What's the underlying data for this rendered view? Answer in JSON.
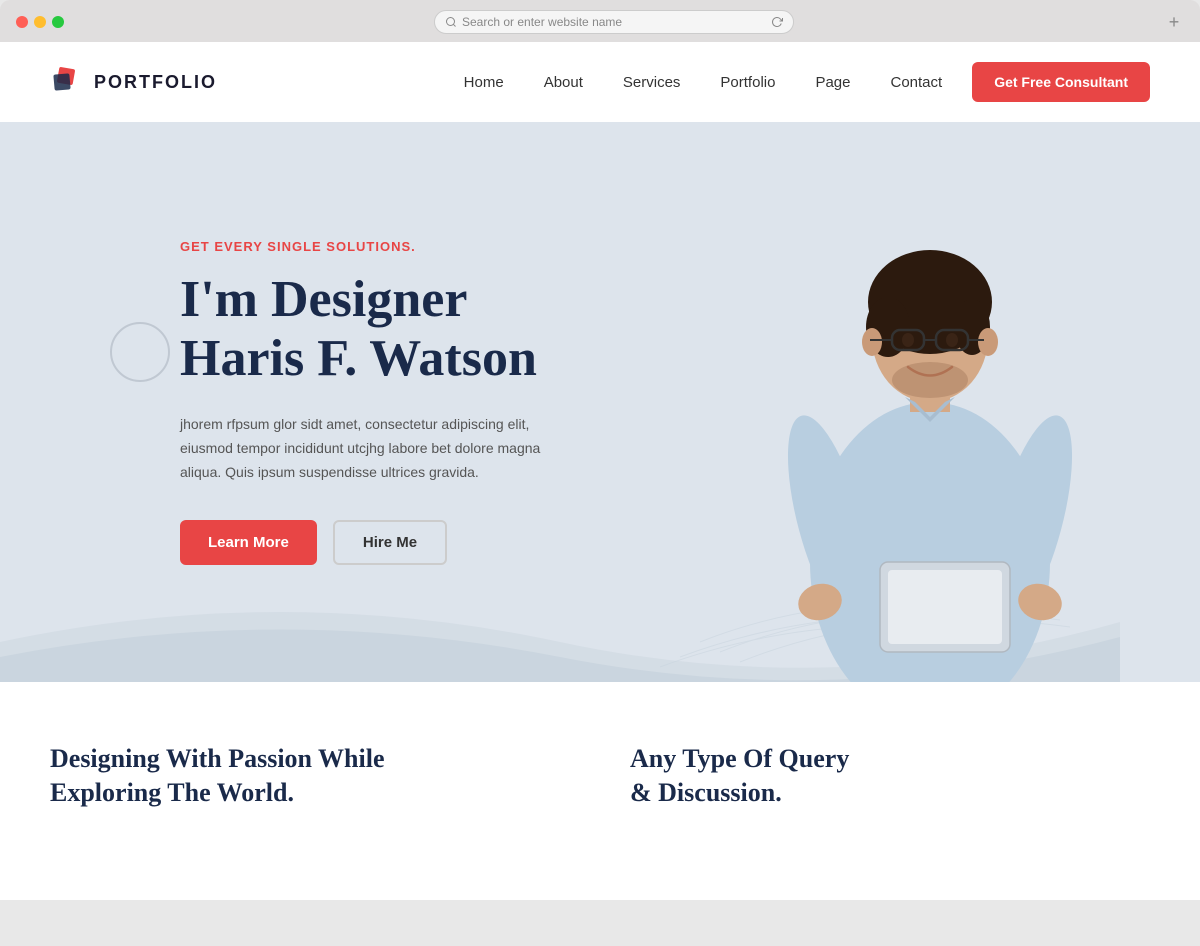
{
  "browser": {
    "address_placeholder": "Search or enter website name"
  },
  "navbar": {
    "logo_text": "PORTFOLIO",
    "nav_items": [
      {
        "label": "Home",
        "id": "home"
      },
      {
        "label": "About",
        "id": "about"
      },
      {
        "label": "Services",
        "id": "services"
      },
      {
        "label": "Portfolio",
        "id": "portfolio"
      },
      {
        "label": "Page",
        "id": "page"
      },
      {
        "label": "Contact",
        "id": "contact"
      }
    ],
    "cta_label": "Get Free Consultant"
  },
  "hero": {
    "tagline": "GET EVERY SINGLE SOLUTIONS.",
    "title_line1": "I'm Designer",
    "title_line2": "Haris F. Watson",
    "description": "jhorem rfpsum glor sidt amet, consectetur adipiscing elit, eiusmod tempor incididunt utcjhg labore bet dolore magna aliqua. Quis ipsum suspendisse ultrices gravida.",
    "btn_learn_more": "Learn More",
    "btn_hire_me": "Hire Me"
  },
  "bottom": {
    "left_heading_line1": "Designing With Passion While",
    "left_heading_line2": "Exploring The World.",
    "right_heading_line1": "Any Type Of Query",
    "right_heading_line2": "& Discussion."
  },
  "colors": {
    "accent": "#e84545",
    "dark_navy": "#1a2a4a",
    "hero_bg": "#dde4ec"
  }
}
